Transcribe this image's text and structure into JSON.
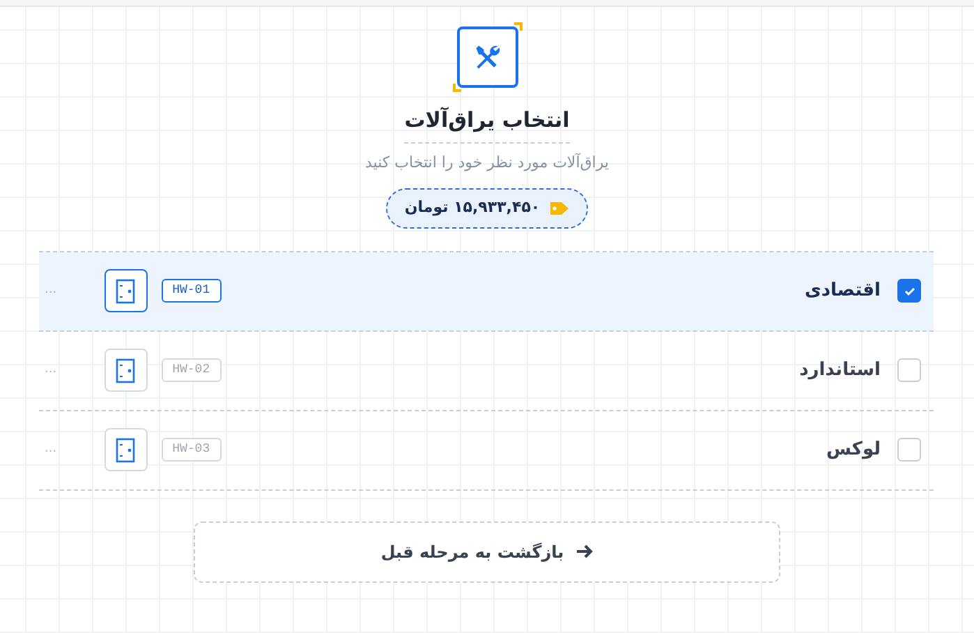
{
  "header": {
    "title": "انتخاب یراق‌آلات",
    "subtitle": "یراق‌آلات مورد نظر خود را انتخاب کنید",
    "price": "۱۵,۹۳۳,۴۵۰ تومان"
  },
  "options": [
    {
      "label": "اقتصادی",
      "code": "HW-01",
      "more": "...",
      "checked": true
    },
    {
      "label": "استاندارد",
      "code": "HW-02",
      "more": "...",
      "checked": false
    },
    {
      "label": "لوکس",
      "code": "HW-03",
      "more": "...",
      "checked": false
    }
  ],
  "back_button": {
    "label": "بازگشت به مرحله قبل"
  }
}
